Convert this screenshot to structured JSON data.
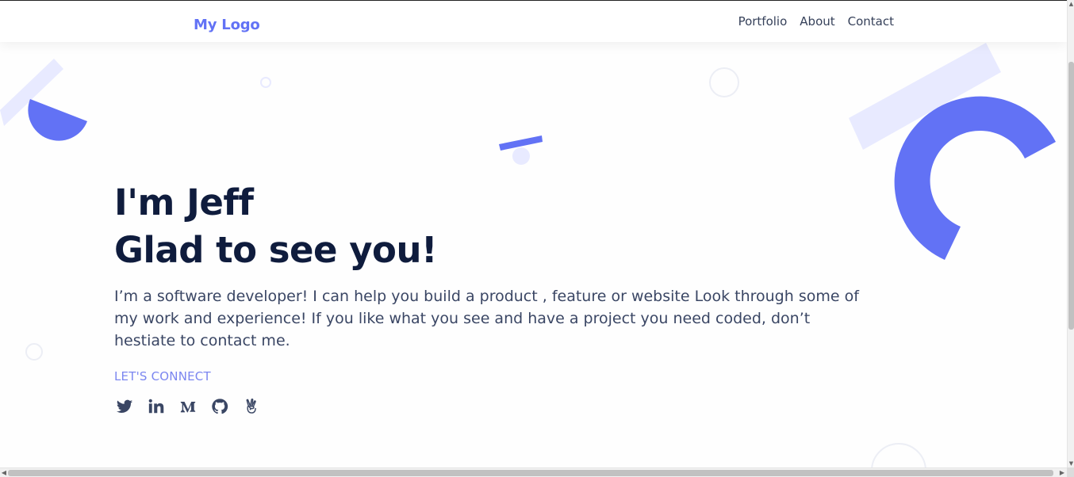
{
  "header": {
    "logo": "My Logo",
    "nav": [
      {
        "label": "Portfolio"
      },
      {
        "label": "About"
      },
      {
        "label": "Contact"
      }
    ]
  },
  "hero": {
    "line1": "I'm Jeff",
    "line2": "Glad to see you!",
    "intro": "I’m a software developer! I can help you build a product , feature or website Look through some of my work and experience! If you like what you see and have a project you need coded, don’t hestiate to contact me.",
    "connect_label": "LET'S CONNECT",
    "social": [
      {
        "icon": "twitter-icon"
      },
      {
        "icon": "linkedin-icon"
      },
      {
        "icon": "medium-icon"
      },
      {
        "icon": "github-icon"
      },
      {
        "icon": "angellist-icon"
      }
    ]
  },
  "colors": {
    "accent": "#6272f5",
    "accent_light": "#e8eaff",
    "heading": "#0f1c3d",
    "body_text": "#3a4664"
  }
}
